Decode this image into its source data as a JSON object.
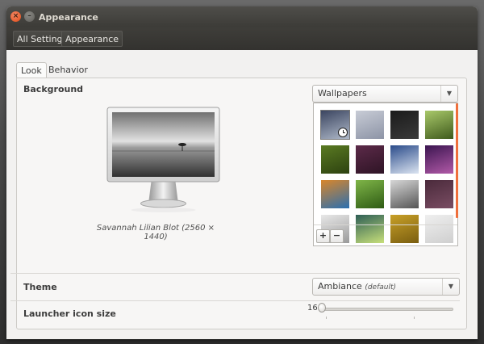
{
  "window": {
    "title": "Appearance"
  },
  "titlebar_buttons": {
    "close": "×",
    "minimize": "–"
  },
  "breadcrumb": {
    "items": [
      {
        "label": "All Settings"
      },
      {
        "label": "Appearance"
      }
    ]
  },
  "tabs": [
    {
      "label": "Look",
      "active": true
    },
    {
      "label": "Behavior",
      "active": false
    }
  ],
  "background": {
    "label": "Background",
    "selected_wallpaper_caption": "Savannah Lilian Blot (2560 × 1440)",
    "source_dropdown": {
      "value": "Wallpapers"
    },
    "thumbnails": [
      {
        "name": "wallpaper-thumb-1",
        "colors": [
          "#3b4560",
          "#aeb8c8"
        ],
        "selected": true
      },
      {
        "name": "wallpaper-thumb-2",
        "colors": [
          "#c8ccd6",
          "#8d94a6"
        ],
        "selected": false
      },
      {
        "name": "wallpaper-thumb-3",
        "colors": [
          "#1b1b1b",
          "#3a3a3a"
        ],
        "selected": false
      },
      {
        "name": "wallpaper-thumb-4",
        "colors": [
          "#a9c96a",
          "#3f5a1c"
        ],
        "selected": false
      },
      {
        "name": "wallpaper-thumb-5",
        "colors": [
          "#5a7a22",
          "#2d4210"
        ],
        "selected": false
      },
      {
        "name": "wallpaper-thumb-6",
        "colors": [
          "#5c2a49",
          "#2e1425"
        ],
        "selected": false
      },
      {
        "name": "wallpaper-thumb-7",
        "colors": [
          "#2a4b8a",
          "#dbe4f1"
        ],
        "selected": false
      },
      {
        "name": "wallpaper-thumb-8",
        "colors": [
          "#3b1550",
          "#b25aa8"
        ],
        "selected": false
      },
      {
        "name": "wallpaper-thumb-9",
        "colors": [
          "#d9862a",
          "#2b6fb0"
        ],
        "selected": false
      },
      {
        "name": "wallpaper-thumb-10",
        "colors": [
          "#7fb548",
          "#2e5b14"
        ],
        "selected": false
      },
      {
        "name": "wallpaper-thumb-11",
        "colors": [
          "#d7d7d7",
          "#555555"
        ],
        "selected": false
      },
      {
        "name": "wallpaper-thumb-12",
        "colors": [
          "#4a2a3b",
          "#7a4d63"
        ],
        "selected": false
      },
      {
        "name": "wallpaper-thumb-13",
        "colors": [
          "#e8e8e8",
          "#9a9a9a"
        ],
        "selected": false
      },
      {
        "name": "wallpaper-thumb-14",
        "colors": [
          "#2d5e55",
          "#c8e07a"
        ],
        "selected": false
      },
      {
        "name": "wallpaper-thumb-15",
        "colors": [
          "#c8a028",
          "#7a5e10"
        ],
        "selected": false
      },
      {
        "name": "wallpaper-thumb-16",
        "colors": [
          "#efefef",
          "#cfcfcf"
        ],
        "selected": false
      }
    ],
    "add_label": "+",
    "remove_label": "−"
  },
  "theme": {
    "label": "Theme",
    "value": "Ambiance",
    "default_note": "(default)"
  },
  "launcher": {
    "label": "Launcher icon size",
    "value": "16",
    "level_fraction": 0.0
  },
  "colors": {
    "accent": "#ef6f3c",
    "titlebar": "#3c3b37",
    "window_bg": "#f2f1f0"
  },
  "icons": {
    "dropdown_arrow": "triangle-down",
    "clock_overlay": "clock"
  }
}
